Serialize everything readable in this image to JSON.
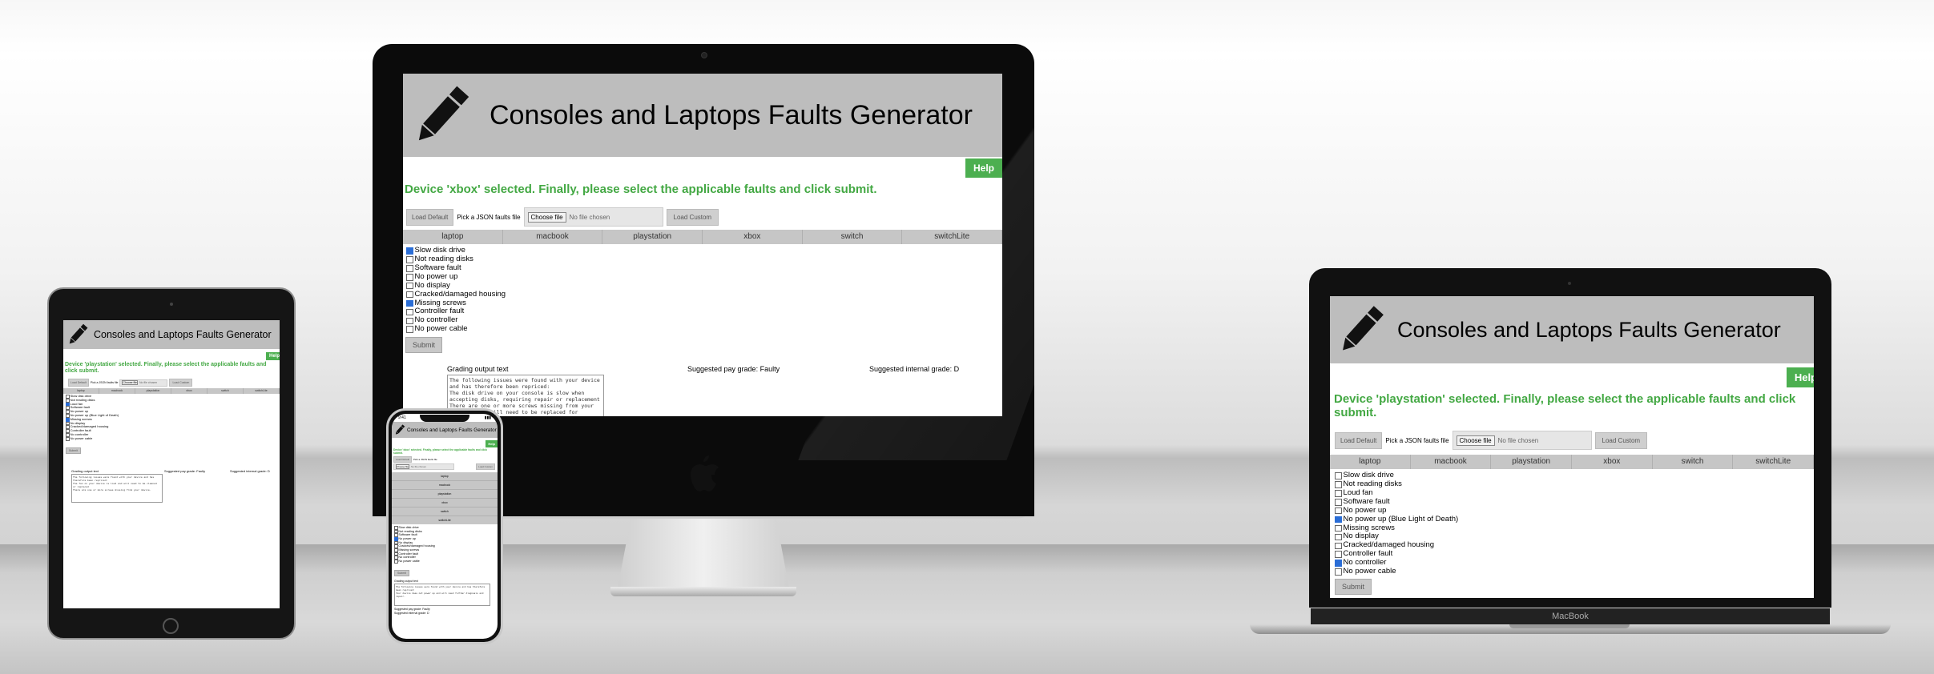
{
  "app": {
    "title": "Consoles and Laptops Faults Generator",
    "help_label": "Help",
    "load_default_label": "Load Default",
    "pick_file_label": "Pick a JSON faults file",
    "choose_file_label": "Choose file",
    "no_file_label": "No file chosen",
    "load_custom_label": "Load Custom",
    "submit_label": "Submit",
    "grading_output_label": "Grading output text",
    "devices": [
      "laptop",
      "macbook",
      "playstation",
      "xbox",
      "switch",
      "switchLite"
    ],
    "colors": {
      "header_bg": "#bdbdbd",
      "accent_green": "#4caf50",
      "message_green": "#43a843"
    }
  },
  "imac": {
    "message": "Device 'xbox' selected. Finally, please select the applicable faults and click submit.",
    "faults": [
      {
        "label": "Slow disk drive",
        "checked": true
      },
      {
        "label": "Not reading disks",
        "checked": false
      },
      {
        "label": "Software fault",
        "checked": false
      },
      {
        "label": "No power up",
        "checked": false
      },
      {
        "label": "No display",
        "checked": false
      },
      {
        "label": "Cracked/damaged housing",
        "checked": false
      },
      {
        "label": "Missing screws",
        "checked": true
      },
      {
        "label": "Controller fault",
        "checked": false
      },
      {
        "label": "No controller",
        "checked": false
      },
      {
        "label": "No power cable",
        "checked": false
      }
    ],
    "pay_grade": "Suggested pay grade: Faulty",
    "internal_grade": "Suggested internal grade: D",
    "output_text": "The following issues were found with your device and has therefore been repriced:\nThe disk drive on your console is slow when accepting disks, requiring repair or replacement\nThere are one or more screws missing from your device which will need to be replaced for resale."
  },
  "macbook": {
    "message": "Device 'playstation' selected. Finally, please select the applicable faults and click submit.",
    "faults": [
      {
        "label": "Slow disk drive",
        "checked": false
      },
      {
        "label": "Not reading disks",
        "checked": false
      },
      {
        "label": "Loud fan",
        "checked": false
      },
      {
        "label": "Software fault",
        "checked": false
      },
      {
        "label": "No power up",
        "checked": false
      },
      {
        "label": "No power up (Blue Light of Death)",
        "checked": true
      },
      {
        "label": "Missing screws",
        "checked": false
      },
      {
        "label": "No display",
        "checked": false
      },
      {
        "label": "Cracked/damaged housing",
        "checked": false
      },
      {
        "label": "Controller fault",
        "checked": false
      },
      {
        "label": "No controller",
        "checked": true
      },
      {
        "label": "No power cable",
        "checked": false
      }
    ],
    "brand_label": "MacBook"
  },
  "ipad": {
    "message": "Device 'playstation' selected. Finally, please select the applicable faults and click submit.",
    "faults": [
      {
        "label": "Slow disk drive",
        "checked": false
      },
      {
        "label": "Not reading disks",
        "checked": false
      },
      {
        "label": "Loud fan",
        "checked": true
      },
      {
        "label": "Software fault",
        "checked": false
      },
      {
        "label": "No power up",
        "checked": false
      },
      {
        "label": "No power up (Blue Light of Death)",
        "checked": false
      },
      {
        "label": "Missing screws",
        "checked": true
      },
      {
        "label": "No display",
        "checked": false
      },
      {
        "label": "Cracked/damaged housing",
        "checked": false
      },
      {
        "label": "Controller fault",
        "checked": false
      },
      {
        "label": "No controller",
        "checked": false
      },
      {
        "label": "No power cable",
        "checked": false
      }
    ],
    "pay_grade": "Suggested pay grade: Faulty",
    "internal_grade": "Suggested internal grade: D",
    "output_text": "The following issues were found with your device and has therefore been repriced:\nThe fan on your device is loud and will need to be cleaned or replaced\nThere are one or more screws missing from your device."
  },
  "iphone": {
    "time": "9:41",
    "message": "Device 'xbox' selected. Finally, please select the applicable faults and click submit.",
    "faults": [
      {
        "label": "Slow disk drive",
        "checked": false
      },
      {
        "label": "Not reading disks",
        "checked": false
      },
      {
        "label": "Software fault",
        "checked": false
      },
      {
        "label": "No power up",
        "checked": true
      },
      {
        "label": "No display",
        "checked": false
      },
      {
        "label": "Cracked/damaged housing",
        "checked": false
      },
      {
        "label": "Missing screws",
        "checked": false
      },
      {
        "label": "Controller fault",
        "checked": false
      },
      {
        "label": "No controller",
        "checked": false
      },
      {
        "label": "No power cable",
        "checked": false
      }
    ],
    "pay_grade": "Suggested pay grade: Faulty",
    "internal_grade": "Suggested internal grade: D",
    "output_text": "The following issues were found with your device and has therefore been repriced:\nYour device does not power up and will need further diagnosis and repair."
  }
}
